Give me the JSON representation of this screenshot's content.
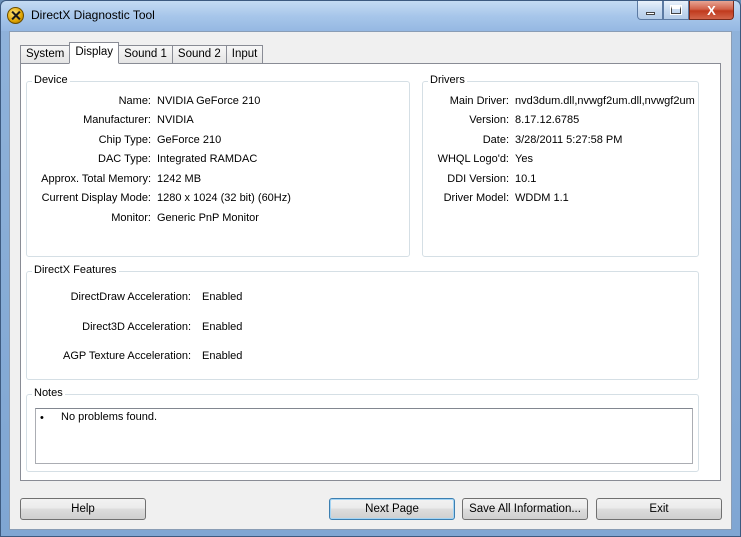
{
  "window": {
    "title": "DirectX Diagnostic Tool"
  },
  "tabs": [
    {
      "label": "System"
    },
    {
      "label": "Display",
      "active": true
    },
    {
      "label": "Sound 1"
    },
    {
      "label": "Sound 2"
    },
    {
      "label": "Input"
    }
  ],
  "device": {
    "heading": "Device",
    "rows": [
      {
        "label": "Name:",
        "value": "NVIDIA GeForce 210"
      },
      {
        "label": "Manufacturer:",
        "value": "NVIDIA"
      },
      {
        "label": "Chip Type:",
        "value": "GeForce 210"
      },
      {
        "label": "DAC Type:",
        "value": "Integrated RAMDAC"
      },
      {
        "label": "Approx. Total Memory:",
        "value": "1242 MB"
      },
      {
        "label": "Current Display Mode:",
        "value": "1280 x 1024 (32 bit) (60Hz)"
      },
      {
        "label": "Monitor:",
        "value": "Generic PnP Monitor"
      }
    ]
  },
  "drivers": {
    "heading": "Drivers",
    "rows": [
      {
        "label": "Main Driver:",
        "value": "nvd3dum.dll,nvwgf2um.dll,nvwgf2um"
      },
      {
        "label": "Version:",
        "value": "8.17.12.6785"
      },
      {
        "label": "Date:",
        "value": "3/28/2011 5:27:58 PM"
      },
      {
        "label": "WHQL Logo'd:",
        "value": "Yes"
      },
      {
        "label": "DDI Version:",
        "value": "10.1"
      },
      {
        "label": "Driver Model:",
        "value": "WDDM 1.1"
      }
    ]
  },
  "features": {
    "heading": "DirectX Features",
    "rows": [
      {
        "label": "DirectDraw Acceleration:",
        "value": "Enabled"
      },
      {
        "label": "Direct3D Acceleration:",
        "value": "Enabled"
      },
      {
        "label": "AGP Texture Acceleration:",
        "value": "Enabled"
      }
    ]
  },
  "notes": {
    "heading": "Notes",
    "bullet": "•",
    "items": [
      "No problems found."
    ]
  },
  "buttons": {
    "help": "Help",
    "next_page": "Next Page",
    "save_all": "Save All Information...",
    "exit": "Exit"
  },
  "caption": {
    "close_glyph": "X"
  }
}
